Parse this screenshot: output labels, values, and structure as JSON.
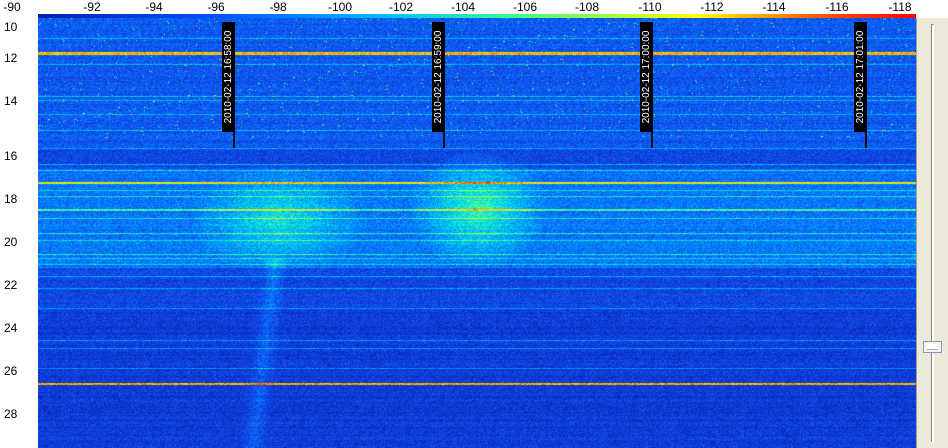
{
  "x_axis": {
    "ticks": [
      "-90",
      "-92",
      "-94",
      "-96",
      "-98",
      "-100",
      "-102",
      "-104",
      "-106",
      "-108",
      "-110",
      "-112",
      "-114",
      "-116",
      "-118"
    ]
  },
  "y_axis": {
    "ticks": [
      "10",
      "12",
      "14",
      "16",
      "18",
      "20",
      "22",
      "24",
      "26",
      "28"
    ]
  },
  "time_markers": [
    {
      "label": "2010-02-12 16:58:00"
    },
    {
      "label": "2010-02-12 16:59:00"
    },
    {
      "label": "2010-02-12 17:00:00"
    },
    {
      "label": "2010-02-12 17:01:00"
    }
  ],
  "slider": {
    "position_fraction": 0.78
  },
  "colors": {
    "background": "#0a2fb0",
    "low": "#0030c0",
    "mid": "#00e0ff",
    "high": "#ffff00",
    "peak": "#ff2000"
  }
}
